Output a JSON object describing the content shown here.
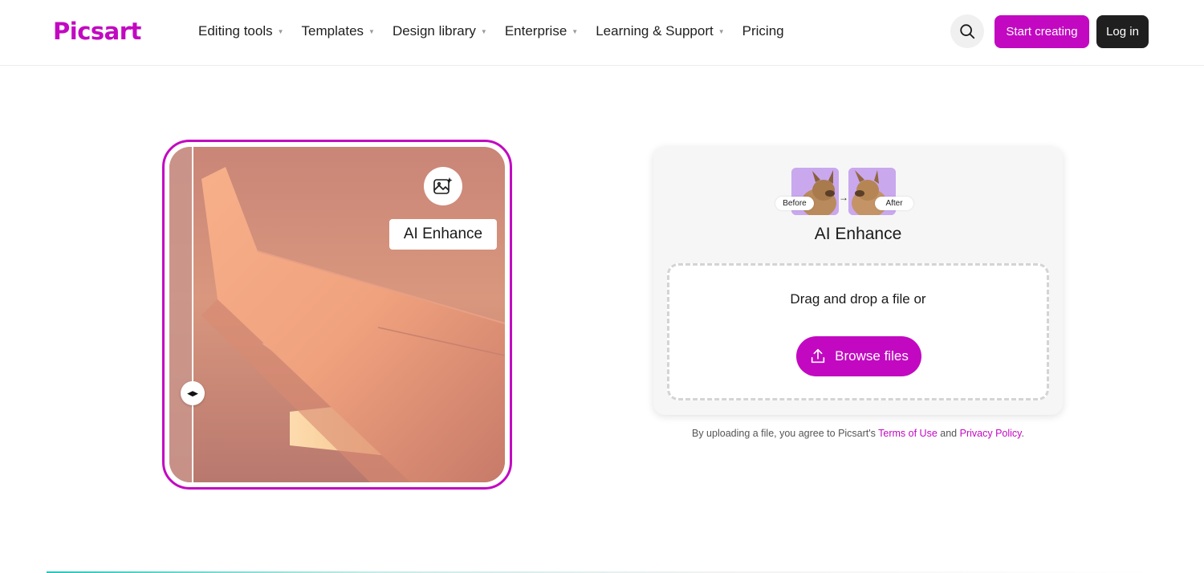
{
  "header": {
    "logo_text": "Picsart",
    "nav": [
      {
        "label": "Editing tools",
        "has_dropdown": true
      },
      {
        "label": "Templates",
        "has_dropdown": true
      },
      {
        "label": "Design library",
        "has_dropdown": true
      },
      {
        "label": "Enterprise",
        "has_dropdown": true
      },
      {
        "label": "Learning & Support",
        "has_dropdown": true
      },
      {
        "label": "Pricing",
        "has_dropdown": false
      }
    ],
    "search_icon": "search-icon",
    "start_label": "Start creating",
    "login_label": "Log in"
  },
  "preview": {
    "badge_icon": "image-sparkle-icon",
    "badge_label": "AI Enhance",
    "handle_glyph": "◀▶",
    "image_subject": "airplane wing at sunset"
  },
  "upload": {
    "before_label": "Before",
    "after_label": "After",
    "arrow_glyph": "→",
    "title": "AI Enhance",
    "drop_text": "Drag and drop a file or",
    "browse_label": "Browse files",
    "terms_prefix": "By uploading a file, you agree to Picsart's",
    "terms_link": "Terms of Use",
    "terms_and": "and",
    "privacy_link": "Privacy Policy",
    "terms_suffix": "."
  },
  "colors": {
    "brand": "#c209c1",
    "dark_button": "#1f1f1f",
    "thumb_bg": "#c9a8ee"
  }
}
